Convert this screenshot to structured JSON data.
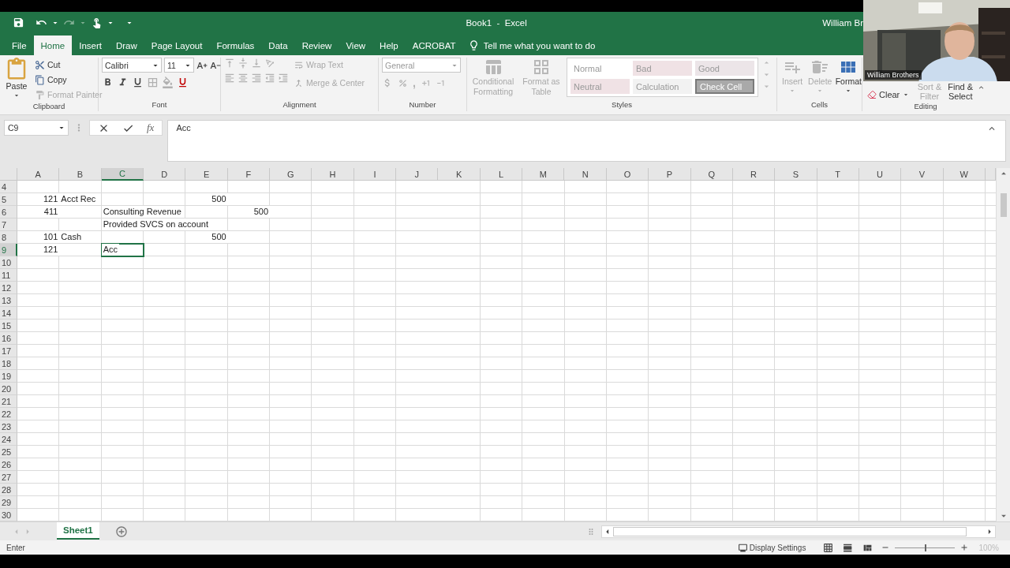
{
  "title_bar": {
    "title": "Book1  -  Excel",
    "account": "William Br"
  },
  "menu_tabs": [
    {
      "label": "File",
      "selected": false
    },
    {
      "label": "Home",
      "selected": true
    },
    {
      "label": "Insert",
      "selected": false
    },
    {
      "label": "Draw",
      "selected": false
    },
    {
      "label": "Page Layout",
      "selected": false
    },
    {
      "label": "Formulas",
      "selected": false
    },
    {
      "label": "Data",
      "selected": false
    },
    {
      "label": "Review",
      "selected": false
    },
    {
      "label": "View",
      "selected": false
    },
    {
      "label": "Help",
      "selected": false
    },
    {
      "label": "ACROBAT",
      "selected": false
    }
  ],
  "tell_me": {
    "placeholder": "Tell me what you want to do"
  },
  "clipboard": {
    "label": "Clipboard",
    "paste": "Paste",
    "buttons": [
      {
        "kind": "cut",
        "label": "Cut",
        "disabled": false
      },
      {
        "kind": "copy",
        "label": "Copy",
        "disabled": false
      },
      {
        "kind": "painter",
        "label": "Format Painter",
        "disabled": true
      }
    ]
  },
  "font": {
    "label": "Font",
    "name": "Calibri",
    "size": "11"
  },
  "alignment": {
    "label": "Alignment",
    "buttons": [
      {
        "kind": "wrap",
        "label": "Wrap Text",
        "disabled": true
      },
      {
        "kind": "merge",
        "label": "Merge & Center",
        "disabled": true
      }
    ]
  },
  "number": {
    "label": "Number",
    "format": "General",
    "comma": ","
  },
  "styles": {
    "label": "Styles",
    "buttons": [
      {
        "kind": "conditional",
        "label": "Conditional Formatting",
        "disabled": true
      },
      {
        "kind": "table",
        "label": "Format as Table",
        "disabled": true
      }
    ],
    "cell_styles": [
      {
        "label": "Normal",
        "color": "#ffffff"
      },
      {
        "label": "Bad",
        "color": "#f0e2e5"
      },
      {
        "label": "Good",
        "color": "#ece5e8"
      },
      {
        "label": "Neutral",
        "color": "#f0e2e5"
      },
      {
        "label": "Calculation",
        "color": "#f2f2f2"
      },
      {
        "label": "Check Cell",
        "color": "#a9a9a9"
      }
    ]
  },
  "cells_group": {
    "label": "Cells",
    "buttons": [
      {
        "kind": "insert",
        "label": "Insert",
        "disabled": true
      },
      {
        "kind": "delete",
        "label": "Delete",
        "disabled": true
      },
      {
        "kind": "format",
        "label": "Format",
        "disabled": false
      }
    ]
  },
  "editing": {
    "label": "Editing",
    "buttons": [
      {
        "kind": "clear",
        "label": "Clear",
        "disabled": false
      },
      {
        "kind": "sort",
        "label": "Sort & Filter",
        "disabled": true
      },
      {
        "kind": "find",
        "label": "Find & Select",
        "disabled": false
      }
    ]
  },
  "name_box": "C9",
  "formula_symbol": "fx",
  "formula": "Acc",
  "columns": [
    {
      "label": "A",
      "selected": false
    },
    {
      "label": "B",
      "selected": false
    },
    {
      "label": "C",
      "selected": true
    },
    {
      "label": "D",
      "selected": false
    },
    {
      "label": "E",
      "selected": false
    },
    {
      "label": "F",
      "selected": false
    },
    {
      "label": "G",
      "selected": false
    },
    {
      "label": "H",
      "selected": false
    },
    {
      "label": "I",
      "selected": false
    },
    {
      "label": "J",
      "selected": false
    },
    {
      "label": "K",
      "selected": false
    },
    {
      "label": "L",
      "selected": false
    },
    {
      "label": "M",
      "selected": false
    },
    {
      "label": "N",
      "selected": false
    },
    {
      "label": "O",
      "selected": false
    },
    {
      "label": "P",
      "selected": false
    },
    {
      "label": "Q",
      "selected": false
    },
    {
      "label": "R",
      "selected": false
    },
    {
      "label": "S",
      "selected": false
    },
    {
      "label": "T",
      "selected": false
    },
    {
      "label": "U",
      "selected": false
    },
    {
      "label": "V",
      "selected": false
    },
    {
      "label": "W",
      "selected": false
    }
  ],
  "rows": [
    {
      "header": "4",
      "selected": false
    },
    {
      "header": "5",
      "selected": false,
      "cells": [
        {
          "text": "121",
          "kind": "number",
          "selected": false
        },
        {
          "text": "Acct Rec",
          "kind": "text",
          "selected": false
        },
        null,
        null,
        {
          "text": "500",
          "kind": "number",
          "selected": false
        }
      ]
    },
    {
      "header": "6",
      "selected": false,
      "cells": [
        {
          "text": "411",
          "kind": "number",
          "selected": false
        },
        null,
        {
          "text": "Consulting Revenue",
          "kind": "text",
          "selected": false
        },
        null,
        null,
        {
          "text": "500",
          "kind": "number",
          "selected": false
        }
      ]
    },
    {
      "header": "7",
      "selected": false,
      "cells": [
        null,
        null,
        {
          "text": "Provided SVCS on account",
          "kind": "text",
          "selected": false
        }
      ]
    },
    {
      "header": "8",
      "selected": false,
      "cells": [
        {
          "text": "101",
          "kind": "number",
          "selected": false
        },
        {
          "text": "Cash",
          "kind": "text",
          "selected": false
        },
        null,
        null,
        {
          "text": "500",
          "kind": "number",
          "selected": false
        }
      ]
    },
    {
      "header": "9",
      "selected": true,
      "cells": [
        {
          "text": "121",
          "kind": "number",
          "selected": false
        },
        null,
        {
          "text": "Acc",
          "kind": "text",
          "selected": true
        }
      ]
    },
    {
      "header": "10",
      "selected": false
    },
    {
      "header": "11",
      "selected": false
    },
    {
      "header": "12",
      "selected": false
    },
    {
      "header": "13",
      "selected": false
    },
    {
      "header": "14",
      "selected": false
    },
    {
      "header": "15",
      "selected": false
    },
    {
      "header": "16",
      "selected": false
    },
    {
      "header": "17",
      "selected": false
    },
    {
      "header": "18",
      "selected": false
    },
    {
      "header": "19",
      "selected": false
    },
    {
      "header": "20",
      "selected": false
    },
    {
      "header": "21",
      "selected": false
    },
    {
      "header": "22",
      "selected": false
    },
    {
      "header": "23",
      "selected": false
    },
    {
      "header": "24",
      "selected": false
    },
    {
      "header": "25",
      "selected": false
    },
    {
      "header": "26",
      "selected": false
    },
    {
      "header": "27",
      "selected": false
    },
    {
      "header": "28",
      "selected": false
    },
    {
      "header": "29",
      "selected": false
    },
    {
      "header": "30",
      "selected": false
    }
  ],
  "sheet_tabs": [
    {
      "label": "Sheet1",
      "selected": true
    }
  ],
  "status_bar": {
    "mode": "Enter",
    "display_settings": "Display Settings",
    "zoom": "100%",
    "zoom_slider": {
      "level": 0.5
    }
  },
  "webcam": {
    "kind": "picture",
    "name": "William Brothers"
  }
}
